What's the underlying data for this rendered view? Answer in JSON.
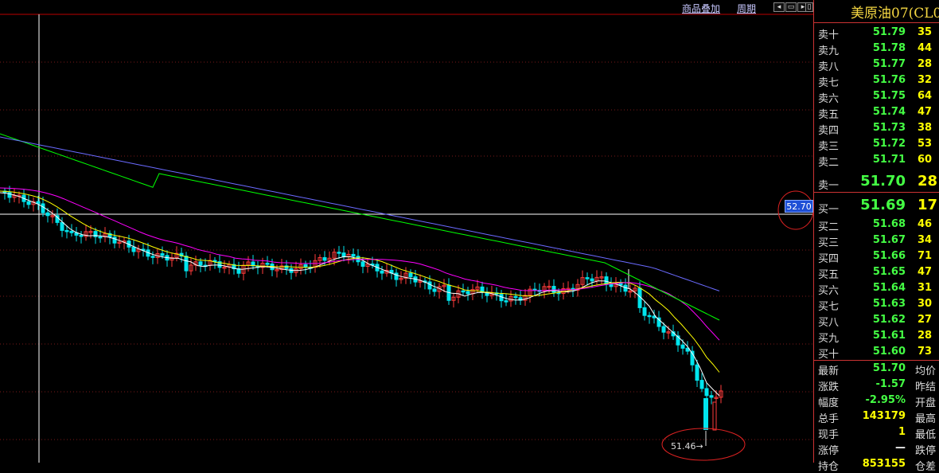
{
  "toolbar": {
    "overlay_label": "商品叠加",
    "period_label": "周期"
  },
  "crosshair": {
    "price_label": "52.70"
  },
  "min_marker": {
    "label": "51.46→"
  },
  "panel": {
    "title": "美原油07(CL0",
    "asks": [
      {
        "label": "卖十",
        "price": "51.79",
        "vol": "35"
      },
      {
        "label": "卖九",
        "price": "51.78",
        "vol": "44"
      },
      {
        "label": "卖八",
        "price": "51.77",
        "vol": "28"
      },
      {
        "label": "卖七",
        "price": "51.76",
        "vol": "32"
      },
      {
        "label": "卖六",
        "price": "51.75",
        "vol": "64"
      },
      {
        "label": "卖五",
        "price": "51.74",
        "vol": "47"
      },
      {
        "label": "卖四",
        "price": "51.73",
        "vol": "38"
      },
      {
        "label": "卖三",
        "price": "51.72",
        "vol": "53"
      },
      {
        "label": "卖二",
        "price": "51.71",
        "vol": "60"
      },
      {
        "label": "卖一",
        "price": "51.70",
        "vol": "28"
      }
    ],
    "bids": [
      {
        "label": "买一",
        "price": "51.69",
        "vol": "17"
      },
      {
        "label": "买二",
        "price": "51.68",
        "vol": "46"
      },
      {
        "label": "买三",
        "price": "51.67",
        "vol": "34"
      },
      {
        "label": "买四",
        "price": "51.66",
        "vol": "71"
      },
      {
        "label": "买五",
        "price": "51.65",
        "vol": "47"
      },
      {
        "label": "买六",
        "price": "51.64",
        "vol": "31"
      },
      {
        "label": "买七",
        "price": "51.63",
        "vol": "30"
      },
      {
        "label": "买八",
        "price": "51.62",
        "vol": "27"
      },
      {
        "label": "买九",
        "price": "51.61",
        "vol": "28"
      },
      {
        "label": "买十",
        "price": "51.60",
        "vol": "73"
      }
    ],
    "stats": [
      {
        "label": "最新",
        "value": "51.70",
        "label2": "均价",
        "color": "green"
      },
      {
        "label": "涨跌",
        "value": "-1.57",
        "label2": "昨结",
        "color": "green"
      },
      {
        "label": "幅度",
        "value": "-2.95%",
        "label2": "开盘",
        "color": "green"
      },
      {
        "label": "总手",
        "value": "143179",
        "label2": "最高",
        "color": "yellow"
      },
      {
        "label": "现手",
        "value": "1",
        "label2": "最低",
        "color": "yellow"
      },
      {
        "label": "涨停",
        "value": "—",
        "label2": "跌停",
        "color": "white"
      },
      {
        "label": "持仓",
        "value": "853155",
        "label2": "仓差",
        "color": "yellow"
      }
    ]
  },
  "colors": {
    "up": "#ff3b3b",
    "down": "#00e5ee",
    "ma5": "#ffffff",
    "ma10": "#ffff00",
    "ma20": "#ff00ff",
    "ma40": "#00ff00",
    "ma60": "#6a6aff"
  }
}
